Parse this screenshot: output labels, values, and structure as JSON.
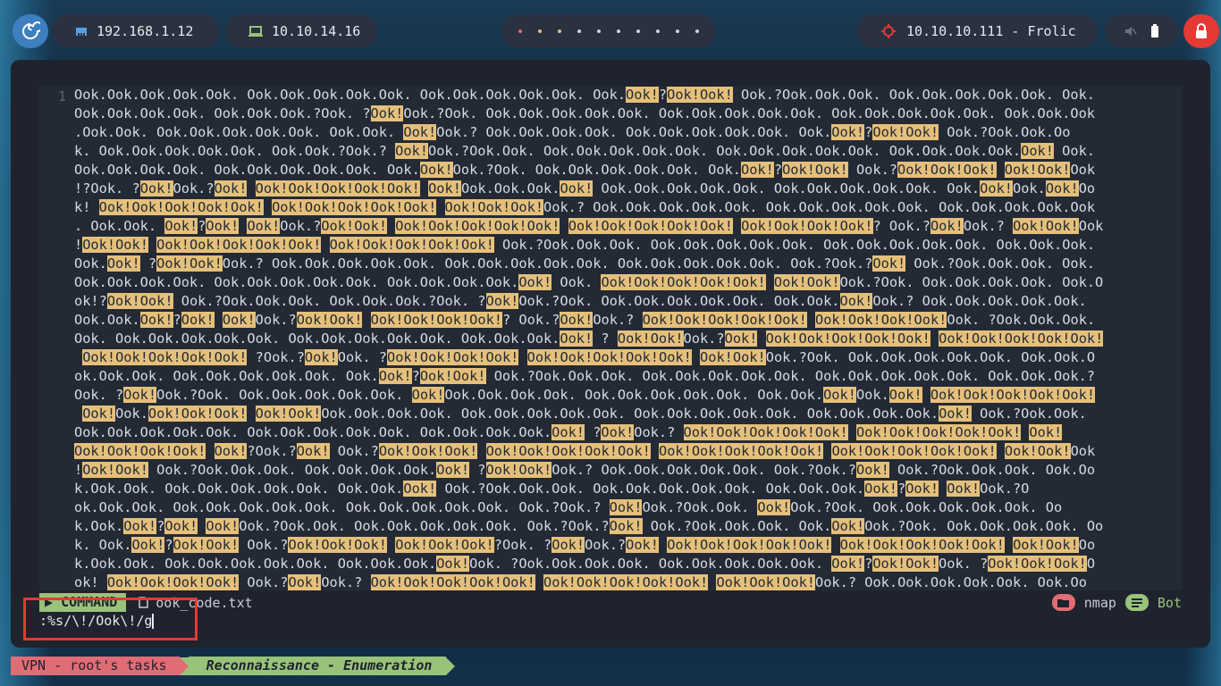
{
  "topbar": {
    "logo_icon": "debian-swirl-icon",
    "host_ip": "192.168.1.12",
    "host_icon": "ethernet-icon",
    "vpn_ip": "10.10.14.16",
    "vpn_icon": "laptop-icon",
    "workspace_dots": [
      "#e06c75",
      "#e5c07b",
      "#e5c07b",
      "#cfd5dc",
      "#cfd5dc",
      "#cfd5dc",
      "#cfd5dc",
      "#cfd5dc",
      "#cfd5dc",
      "#cfd5dc"
    ],
    "target": "10.10.10.111 - Frolic",
    "target_icon": "crosshair-icon",
    "mute_icon": "mute-icon",
    "battery_icon": "battery-icon",
    "lock_icon": "lock-icon"
  },
  "editor": {
    "line_number": "1",
    "lines": [
      "Ook.Ook.Ook.Ook.Ook. Ook.Ook.Ook.Ook.Ook. Ook.Ook.Ook.Ook.Ook. Ook.Ook!?Ook!Ook! Ook.?Ook.Ook.Ook. Ook.Ook.Ook.Ook.Ook. Ook.",
      "Ook.Ook.Ook.Ook. Ook.Ook.Ook.?Ook. ?Ook!Ook.?Ook. Ook.Ook.Ook.Ook.Ook. Ook.Ook.Ook.Ook.Ook. Ook.Ook.Ook.Ook.Ook. Ook.Ook.Ook",
      ".Ook.Ook. Ook.Ook.Ook.Ook.Ook. Ook.Ook. Ook!Ook.? Ook.Ook.Ook.Ook. Ook.Ook.Ook.Ook.Ook. Ook.Ook!?Ook!Ook! Ook.?Ook.Ook.Oo",
      "k. Ook.Ook.Ook.Ook.Ook. Ook.Ook.?Ook.? Ook!Ook.?Ook.Ook. Ook.Ook.Ook.Ook.Ook. Ook.Ook.Ook.Ook.Ook. Ook.Ook.Ook.Ook.Ook! Ook.",
      "Ook.Ook.Ook.Ook. Ook.Ook.Ook.Ook.Ook. Ook.Ook!Ook.?Ook. Ook.Ook.Ook.Ook.Ook. Ook.Ook!?Ook!Ook! Ook.?Ook!Ook!Ook! Ook!Ook!Ook",
      "!?Ook. ?Ook!Ook.?Ook! Ook!Ook!Ook!Ook!Ook! Ook!Ook.Ook.Ook.Ook! Ook.Ook.Ook.Ook.Ook. Ook.Ook.Ook.Ook.Ook. Ook.Ook!Ook.Ook!Oo",
      "k! Ook!Ook!Ook!Ook!Ook! Ook!Ook!Ook!Ook!Ook! Ook!Ook!Ook!Ook.? Ook.Ook.Ook.Ook.Ook. Ook.Ook.Ook.Ook.Ook. Ook.Ook.Ook.Ook.Ook",
      ". Ook.Ook. Ook!?Ook! Ook!Ook.?Ook!Ook! Ook!Ook!Ook!Ook!Ook! Ook!Ook!Ook!Ook!Ook! Ook!Ook!Ook!Ook!? Ook.?Ook!Ook.? Ook!Ook!Ook",
      "!Ook!Ook! Ook!Ook!Ook!Ook!Ook! Ook!Ook!Ook!Ook!Ook! Ook.?Ook.Ook.Ook. Ook.Ook.Ook.Ook.Ook. Ook.Ook.Ook.Ook.Ook. Ook.Ook.Ook.",
      "Ook.Ook! ?Ook!Ook!Ook.? Ook.Ook.Ook.Ook.Ook. Ook.Ook.Ook.Ook.Ook. Ook.Ook.Ook.Ook.Ook. Ook.?Ook.?Ook! Ook.?Ook.Ook.Ook. Ook.",
      "Ook.Ook.Ook.Ook. Ook.Ook.Ook.Ook.Ook. Ook.Ook.Ook.Ook.Ook! Ook. Ook!Ook!Ook!Ook!Ook! Ook!Ook!Ook.?Ook. Ook.Ook.Ook.Ook. Ook.O",
      "ok!?Ook!Ook! Ook.?Ook.Ook.Ook. Ook.Ook.Ook.?Ook. ?Ook!Ook.?Ook. Ook.Ook.Ook.Ook.Ook. Ook.Ook.Ook!Ook.? Ook.Ook.Ook.Ook.Ook.",
      "Ook.Ook.Ook!?Ook! Ook!Ook.?Ook!Ook! Ook!Ook!Ook!Ook!? Ook.?Ook!Ook.? Ook!Ook!Ook!Ook!Ook! Ook!Ook!Ook!Ook!Ook. ?Ook.Ook.Ook.",
      "Ook. Ook.Ook.Ook.Ook.Ook. Ook.Ook.Ook.Ook.Ook. Ook.Ook.Ook.Ook! ? Ook!Ook!Ook.?Ook! Ook!Ook!Ook!Ook!Ook! Ook!Ook!Ook!Ook!Ook!",
      " Ook!Ook!Ook!Ook!Ook! ?Ook.?Ook!Ook. ?Ook!Ook!Ook!Ook! Ook!Ook!Ook!Ook!Ook! Ook!Ook!Ook.?Ook. Ook.Ook.Ook.Ook.Ook. Ook.Ook.O",
      "ok.Ook.Ook. Ook.Ook.Ook.Ook.Ook. Ook.Ook!?Ook!Ook! Ook.?Ook.Ook.Ook. Ook.Ook.Ook.Ook.Ook. Ook.Ook.Ook.Ook.Ook. Ook.Ook.Ook.?",
      "Ook. ?Ook!Ook.?Ook. Ook.Ook.Ook.Ook.Ook. Ook!Ook.Ook.Ook.Ook. Ook.Ook.Ook.Ook.Ook. Ook.Ook.Ook!Ook.Ook! Ook!Ook!Ook!Ook!Ook!",
      " Ook!Ook.Ook!Ook!Ook! Ook!Ook!Ook.Ook.Ook.Ook. Ook.Ook.Ook.Ook.Ook. Ook.Ook.Ook.Ook.Ook. Ook.Ook.Ook.Ook.Ook! Ook.?Ook.Ook.",
      "Ook.Ook.Ook.Ook.Ook. Ook.Ook.Ook.Ook.Ook. Ook.Ook.Ook.Ook.Ook! ?Ook!Ook.? Ook!Ook!Ook!Ook!Ook! Ook!Ook!Ook!Ook!Ook! Ook!",
      "Ook!Ook!Ook!Ook! Ook!?Ook.?Ook! Ook.?Ook!Ook!Ook! Ook!Ook!Ook!Ook!Ook! Ook!Ook!Ook!Ook!Ook! Ook!Ook!Ook!Ook!Ook! Ook!Ook!Ook",
      "!Ook!Ook! Ook.?Ook.Ook.Ook. Ook.Ook.Ook.Ook.Ook! ?Ook!Ook!Ook.? Ook.Ook.Ook.Ook.Ook. Ook.?Ook.?Ook! Ook.?Ook.Ook.Ook. Ook.Oo",
      "k.Ook.Ook. Ook.Ook.Ook.Ook.Ook. Ook.Ook.Ook! Ook.?Ook.Ook.Ook. Ook.Ook.Ook.Ook.Ook. Ook.Ook.Ook.Ook!?Ook! Ook!Ook.?O",
      "ok.Ook.Ook. Ook.Ook.Ook.Ook.Ook. Ook.Ook.Ook.Ook.Ook. Ook.?Ook.? Ook!Ook.?Ook.Ook. Ook!Ook.?Ook. Ook.Ook.Ook.Ook.Ook. Oo",
      "k.Ook.Ook!?Ook! Ook!Ook.?Ook.Ook. Ook.Ook.Ook.Ook.Ook. Ook.?Ook.?Ook! Ook.?Ook.Ook.Ook. Ook.Ook!Ook.?Ook. Ook.Ook.Ook.Ook. Oo",
      "k. Ook.Ook!?Ook!Ook! Ook.?Ook!Ook!Ook! Ook!Ook!Ook!?Ook. ?Ook!Ook.?Ook! Ook!Ook!Ook!Ook!Ook! Ook!Ook!Ook!Ook!Ook! Ook!Ook!Oo",
      "k.Ook.Ook. Ook.Ook.Ook.Ook.Ook. Ook.Ook.Ook.Ook!Ook. ?Ook.Ook.Ook.Ook. Ook.Ook.Ook.Ook.Ook. Ook!?Ook!Ook!Ook. ?Ook!Ook!Ook!O",
      "ok! Ook!Ook!Ook!Ook! Ook.?Ook!Ook.? Ook!Ook!Ook!Ook!Ook! Ook!Ook!Ook!Ook!Ook! Ook!Ook!Ook!Ook.? Ook.Ook.Ook.Ook.Ook. Ook.Oo"
    ]
  },
  "status": {
    "mode_icon": "play-icon",
    "mode": "COMMAND",
    "file_icon": "file-icon",
    "filename": "ook_code.txt",
    "folder_icon": "folder-icon",
    "session": "nmap",
    "position_icon": "lines-icon",
    "position": "Bot"
  },
  "cmdline": {
    "text": ":%s/\\!/Ook\\!/g"
  },
  "tmux": {
    "session": "VPN - root's tasks",
    "window": "Reconnaissance - Enumeration"
  },
  "colors": {
    "highlight": "#e5c07b",
    "mode_green": "#98c379",
    "tmux_pink": "#e06c75",
    "annotation_red": "#e53935"
  }
}
